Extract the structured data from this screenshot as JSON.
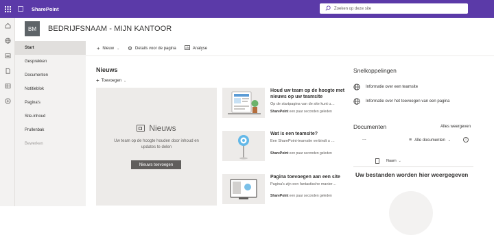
{
  "suitebar": {
    "brand": "SharePoint",
    "search_placeholder": "Zoeken op deze site"
  },
  "site": {
    "logo_initials": "BM",
    "title": "BEDRIJFSNAAM - MIJN KANTOOR"
  },
  "leftnav": {
    "items": [
      {
        "label": "Start"
      },
      {
        "label": "Gesprekken"
      },
      {
        "label": "Documenten"
      },
      {
        "label": "Notitieblok"
      },
      {
        "label": "Pagina's"
      },
      {
        "label": "Site-inhoud"
      },
      {
        "label": "Prullenbak"
      },
      {
        "label": "Bewerken"
      }
    ]
  },
  "commandbar": {
    "new_label": "Nieuw",
    "details_label": "Details voor de pagina",
    "analytics_label": "Analyse"
  },
  "news": {
    "title": "Nieuws",
    "add_label": "Toevoegen",
    "hero": {
      "label": "Nieuws",
      "description": "Uw team op de hoogte houden door inhoud en updates te delen",
      "button": "Nieuws toevoegen"
    },
    "cards": [
      {
        "title": "Houd uw team op de hoogte met nieuws op uw teamsite",
        "description": "Op de startpagina van de site kunt u…",
        "author": "SharePoint",
        "time": "een paar seconden geleden"
      },
      {
        "title": "Wat is een teamsite?",
        "description": "Een SharePoint-teamsite verbindt u …",
        "author": "SharePoint",
        "time": "een paar seconden geleden"
      },
      {
        "title": "Pagina toevoegen aan een site",
        "description": "Pagina's zijn een fantastische manier…",
        "author": "SharePoint",
        "time": "een paar seconden geleden"
      }
    ]
  },
  "quicklinks": {
    "title": "Snelkoppelingen",
    "items": [
      {
        "label": "Informatie over een teamsite"
      },
      {
        "label": "Informatie over het toevoegen van een pagina"
      }
    ]
  },
  "documents": {
    "title": "Documenten",
    "view_all": "Alles weergeven",
    "more": "...",
    "view_label": "Alle documenten",
    "column_name": "Naam",
    "empty_message": "Uw bestanden worden hier weergegeven"
  },
  "colors": {
    "suitebar": "#5b3aa8",
    "nav_background": "#f3f2f1",
    "hero_background": "#edebe9",
    "button": "#605e5c"
  }
}
